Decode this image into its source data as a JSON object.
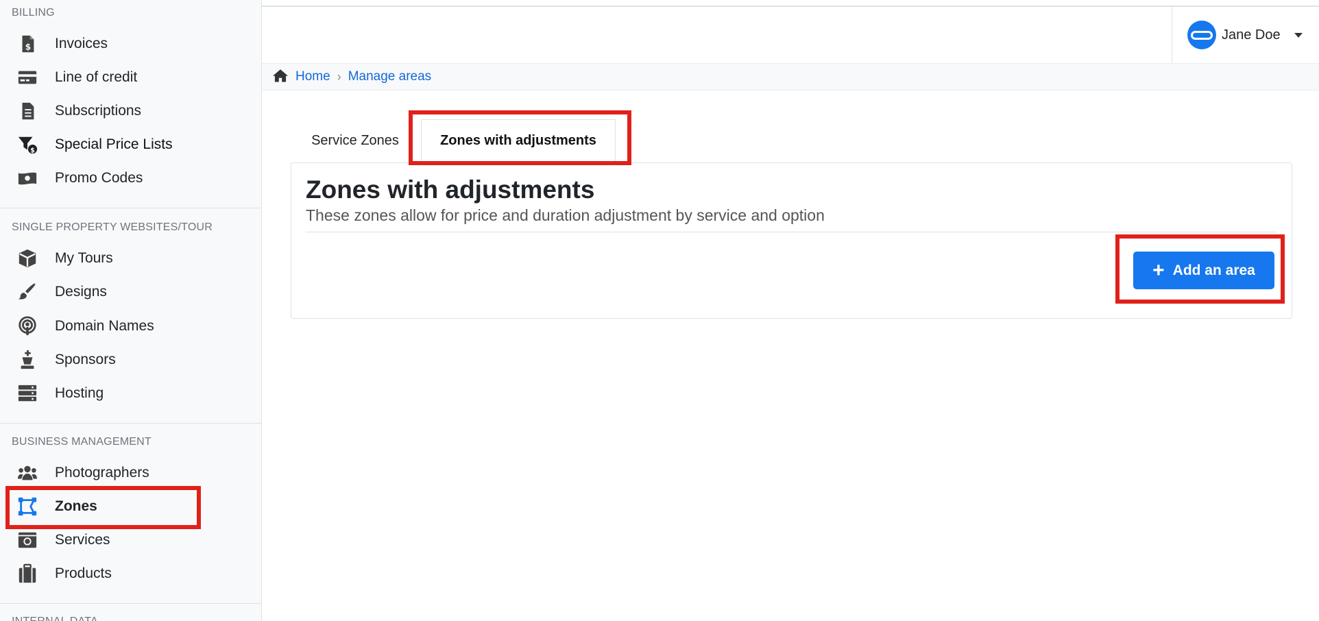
{
  "sidebar": {
    "sections": [
      {
        "title": "BILLING",
        "items": [
          {
            "label": "Invoices",
            "icon": "invoice-icon"
          },
          {
            "label": "Line of credit",
            "icon": "credit-card-icon"
          },
          {
            "label": "Subscriptions",
            "icon": "subscription-icon"
          },
          {
            "label": "Special Price Lists",
            "icon": "filter-dollar-icon"
          },
          {
            "label": "Promo Codes",
            "icon": "money-icon"
          }
        ]
      },
      {
        "title": "SINGLE PROPERTY WEBSITES/TOUR",
        "items": [
          {
            "label": "My Tours",
            "icon": "cube-icon"
          },
          {
            "label": "Designs",
            "icon": "paintbrush-icon"
          },
          {
            "label": "Domain Names",
            "icon": "podcast-icon"
          },
          {
            "label": "Sponsors",
            "icon": "chess-king-icon"
          },
          {
            "label": "Hosting",
            "icon": "server-icon"
          }
        ]
      },
      {
        "title": "BUSINESS MANAGEMENT",
        "items": [
          {
            "label": "Photographers",
            "icon": "users-icon"
          },
          {
            "label": "Zones",
            "icon": "draw-polygon-icon"
          },
          {
            "label": "Services",
            "icon": "camera-retro-icon"
          },
          {
            "label": "Products",
            "icon": "suitcase-icon"
          }
        ]
      },
      {
        "title": "INTERNAL DATA"
      }
    ]
  },
  "header": {
    "user_name": "Jane Doe"
  },
  "breadcrumb": {
    "home": "Home",
    "current": "Manage areas"
  },
  "tabs": [
    {
      "label": "Service Zones"
    },
    {
      "label": "Zones with adjustments"
    }
  ],
  "panel": {
    "title": "Zones with adjustments",
    "subtitle": "These zones allow for price and duration adjustment by service and option",
    "add_button_label": "Add an area",
    "add_button_icon": "+"
  },
  "colors": {
    "accent": "#1677ee",
    "highlight": "#e0211a",
    "link": "#1468d8"
  }
}
